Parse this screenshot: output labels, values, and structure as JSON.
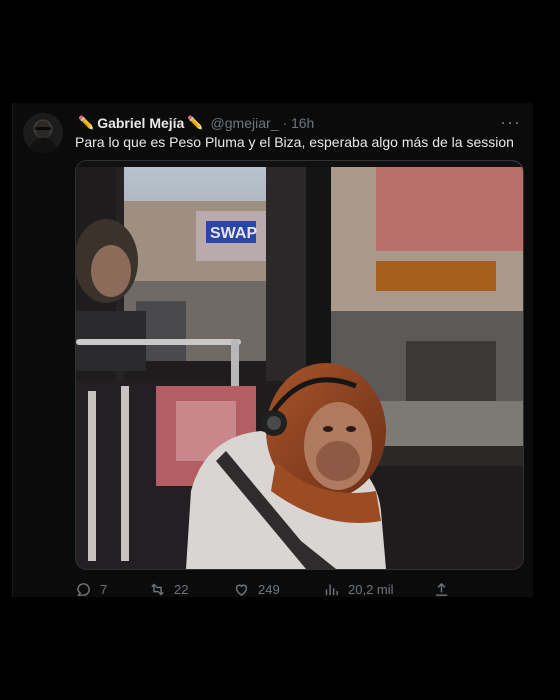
{
  "tweet": {
    "author_name": "Gabriel Mejía",
    "name_emoji": "✏️",
    "handle": "@gmejiar_",
    "time": "· 16h",
    "more": "···",
    "text": "Para lo que es Peso Pluma y el Biza, esperaba algo más de la session"
  },
  "media": {
    "description_icon": "orangutan-on-bus-photo",
    "store_sign": "SWAP"
  },
  "actions": {
    "replies": "7",
    "retweets": "22",
    "likes": "249",
    "views": "20,2 mil"
  },
  "colors": {
    "background": "#000000",
    "card": "#0b0b0b",
    "muted": "#71767b",
    "text": "#e7e9ea"
  }
}
